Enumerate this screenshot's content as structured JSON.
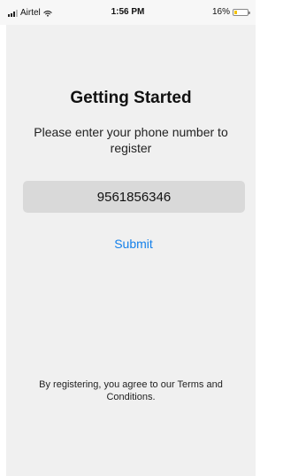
{
  "status_bar": {
    "carrier": "Airtel",
    "time": "1:56 PM",
    "battery": "16%",
    "signal_icon": "signal-bars-icon",
    "wifi_icon": "wifi-icon",
    "battery_icon": "battery-icon"
  },
  "screen": {
    "title": "Getting Started",
    "subtitle": "Please enter your phone number to register",
    "phone_value": "9561856346",
    "submit_label": "Submit",
    "terms_text": "By registering, you agree to our Terms and Conditions.",
    "accent_color": "#1480ea"
  }
}
